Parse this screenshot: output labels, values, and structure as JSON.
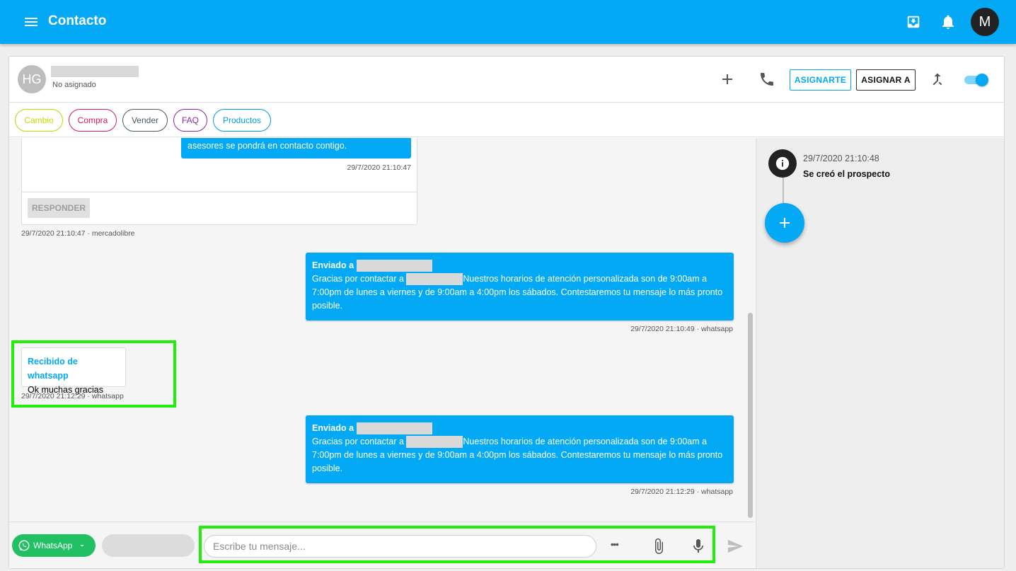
{
  "app": {
    "title": "Contacto",
    "user_initial": "M",
    "accent": "#03a9f4"
  },
  "contact": {
    "initials": "HG",
    "status": "No asignado"
  },
  "actions": {
    "assign_me": "ASIGNARTE",
    "assign_to": "ASIGNAR A"
  },
  "tags": [
    {
      "label": "Cambio",
      "color": "#c6d600"
    },
    {
      "label": "Compra",
      "color": "#d81b60"
    },
    {
      "label": "Vender",
      "color": "#455a64"
    },
    {
      "label": "FAQ",
      "color": "#8e24aa"
    },
    {
      "label": "Productos",
      "color": "#039be5"
    }
  ],
  "messages": {
    "card": {
      "bubble_text": "asesores se pondrá en contacto contigo.",
      "bubble_time": "29/7/2020 21:10:47",
      "reply_label": "RESPONDER",
      "meta": "29/7/2020 21:10:47 · mercadolibre"
    },
    "sent1": {
      "header": "Enviado a",
      "prefix": "Gracias por contactar a",
      "body": "Nuestros horarios de atención personalizada son de 9:00am a 7:00pm de lunes a viernes y de 9:00am a 4:00pm los sábados. Contestaremos tu mensaje lo más pronto posible.",
      "meta": "29/7/2020 21:10:49 · whatsapp"
    },
    "received": {
      "header": "Recibido de whatsapp",
      "body": "Ok muchas gracias",
      "meta": "29/7/2020 21:12:29 · whatsapp"
    },
    "sent2": {
      "header": "Enviado a",
      "prefix": "Gracias por contactar a",
      "body": "Nuestros horarios de atención personalizada son de 9:00am a 7:00pm de lunes a viernes y de 9:00am a 4:00pm los sábados. Contestaremos tu mensaje lo más pronto posible.",
      "meta": "29/7/2020 21:12:29 · whatsapp"
    }
  },
  "composer": {
    "channel": "WhatsApp",
    "placeholder": "Escribe tu mensaje...",
    "more": "•••"
  },
  "timeline": [
    {
      "time": "29/7/2020 21:10:48",
      "text": "Se creó el prospecto"
    }
  ],
  "highlight_color": "#22ee0b"
}
